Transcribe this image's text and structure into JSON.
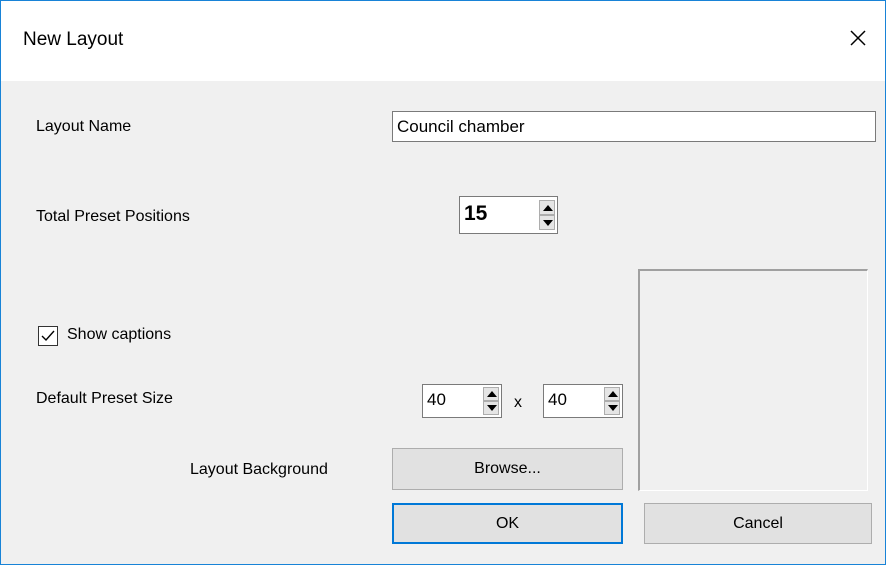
{
  "dialog": {
    "title": "New Layout",
    "close_icon": "close-icon"
  },
  "layout_name": {
    "label": "Layout Name",
    "value": "Council chamber"
  },
  "total_presets": {
    "label": "Total Preset Positions",
    "value": "15"
  },
  "show_captions": {
    "label": "Show captions",
    "checked": true
  },
  "preset_size": {
    "label": "Default Preset Size",
    "width": "40",
    "separator": "x",
    "height": "40"
  },
  "background": {
    "label": "Layout Background",
    "browse_label": "Browse..."
  },
  "buttons": {
    "ok_label": "OK",
    "cancel_label": "Cancel"
  },
  "colors": {
    "window_border": "#1883d7",
    "dialog_bg": "#f0f0f0",
    "default_button_border": "#0078d7"
  }
}
